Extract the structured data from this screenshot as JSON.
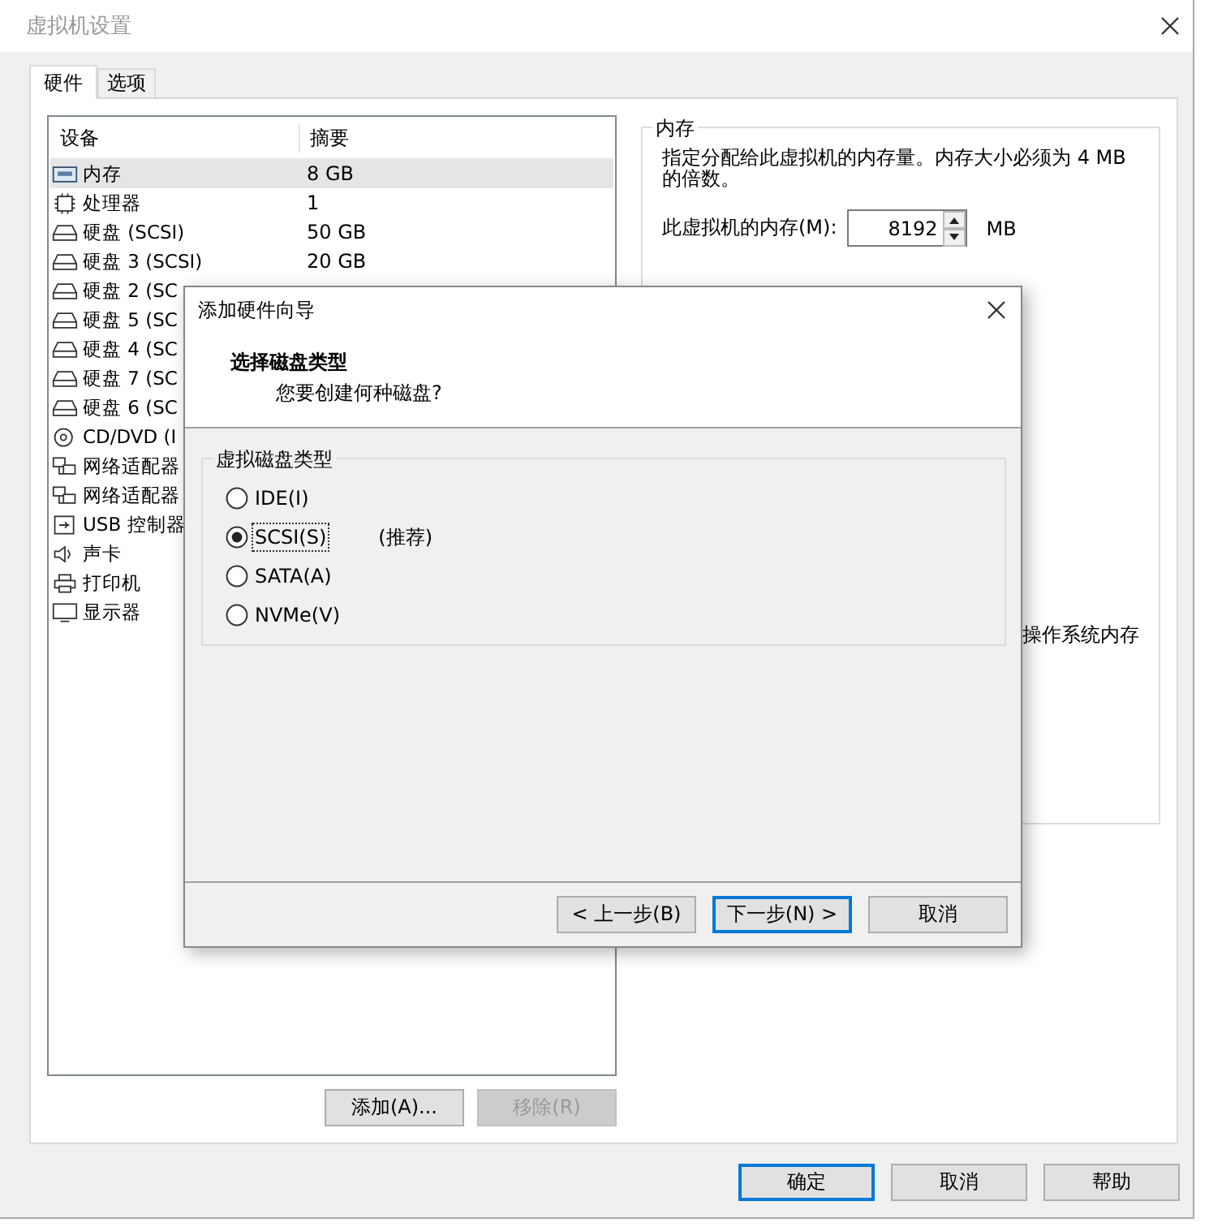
{
  "window": {
    "title": "虚拟机设置"
  },
  "tabs": [
    {
      "label": "硬件",
      "selected": true
    },
    {
      "label": "选项",
      "selected": false
    }
  ],
  "device_list": {
    "columns": [
      "设备",
      "摘要"
    ],
    "rows": [
      {
        "kind": "memory",
        "name": "内存",
        "summary": "8 GB",
        "selected": true
      },
      {
        "kind": "cpu",
        "name": "处理器",
        "summary": "1",
        "selected": false
      },
      {
        "kind": "disk",
        "name": "硬盘 (SCSI)",
        "summary": "50 GB",
        "selected": false
      },
      {
        "kind": "disk",
        "name": "硬盘 3 (SCSI)",
        "summary": "20 GB",
        "selected": false
      },
      {
        "kind": "disk",
        "name": "硬盘 2 (SC",
        "selected": false
      },
      {
        "kind": "disk",
        "name": "硬盘 5 (SC",
        "selected": false
      },
      {
        "kind": "disk",
        "name": "硬盘 4 (SC",
        "selected": false
      },
      {
        "kind": "disk",
        "name": "硬盘 7 (SC",
        "selected": false
      },
      {
        "kind": "disk",
        "name": "硬盘 6 (SC",
        "selected": false
      },
      {
        "kind": "cdrom",
        "name": "CD/DVD (I",
        "selected": false
      },
      {
        "kind": "network",
        "name": "网络适配器",
        "selected": false
      },
      {
        "kind": "network",
        "name": "网络适配器",
        "selected": false
      },
      {
        "kind": "usb",
        "name": "USB 控制器",
        "selected": false
      },
      {
        "kind": "sound",
        "name": "声卡",
        "selected": false
      },
      {
        "kind": "printer",
        "name": "打印机",
        "selected": false
      },
      {
        "kind": "display",
        "name": "显示器",
        "selected": false
      }
    ]
  },
  "list_buttons": [
    {
      "label": "添加(A)...",
      "disabled": false
    },
    {
      "label": "移除(R)",
      "disabled": true
    }
  ],
  "memory_group": {
    "title": "内存",
    "description": "指定分配给此虚拟机的内存量。内存大小必须为 4 MB 的倍数。",
    "field_label": "此虚拟机的内存(M):",
    "value": "8192",
    "unit": "MB",
    "partial_text": "操作系统内存"
  },
  "footer_buttons": [
    {
      "label": "确定",
      "default": true
    },
    {
      "label": "取消",
      "default": false
    },
    {
      "label": "帮助",
      "default": false
    }
  ],
  "dialog": {
    "title": "添加硬件向导",
    "heading": "选择磁盘类型",
    "subheading": "您要创建何种磁盘?",
    "group_title": "虚拟磁盘类型",
    "options": [
      {
        "label": "IDE(I)",
        "selected": false
      },
      {
        "label": "SCSI(S)",
        "selected": true,
        "note": "(推荐)"
      },
      {
        "label": "SATA(A)",
        "selected": false
      },
      {
        "label": "NVMe(V)",
        "selected": false
      }
    ],
    "buttons": [
      {
        "label": "< 上一步(B)",
        "default": false
      },
      {
        "label": "下一步(N) >",
        "default": true
      },
      {
        "label": "取消",
        "default": false
      }
    ]
  }
}
